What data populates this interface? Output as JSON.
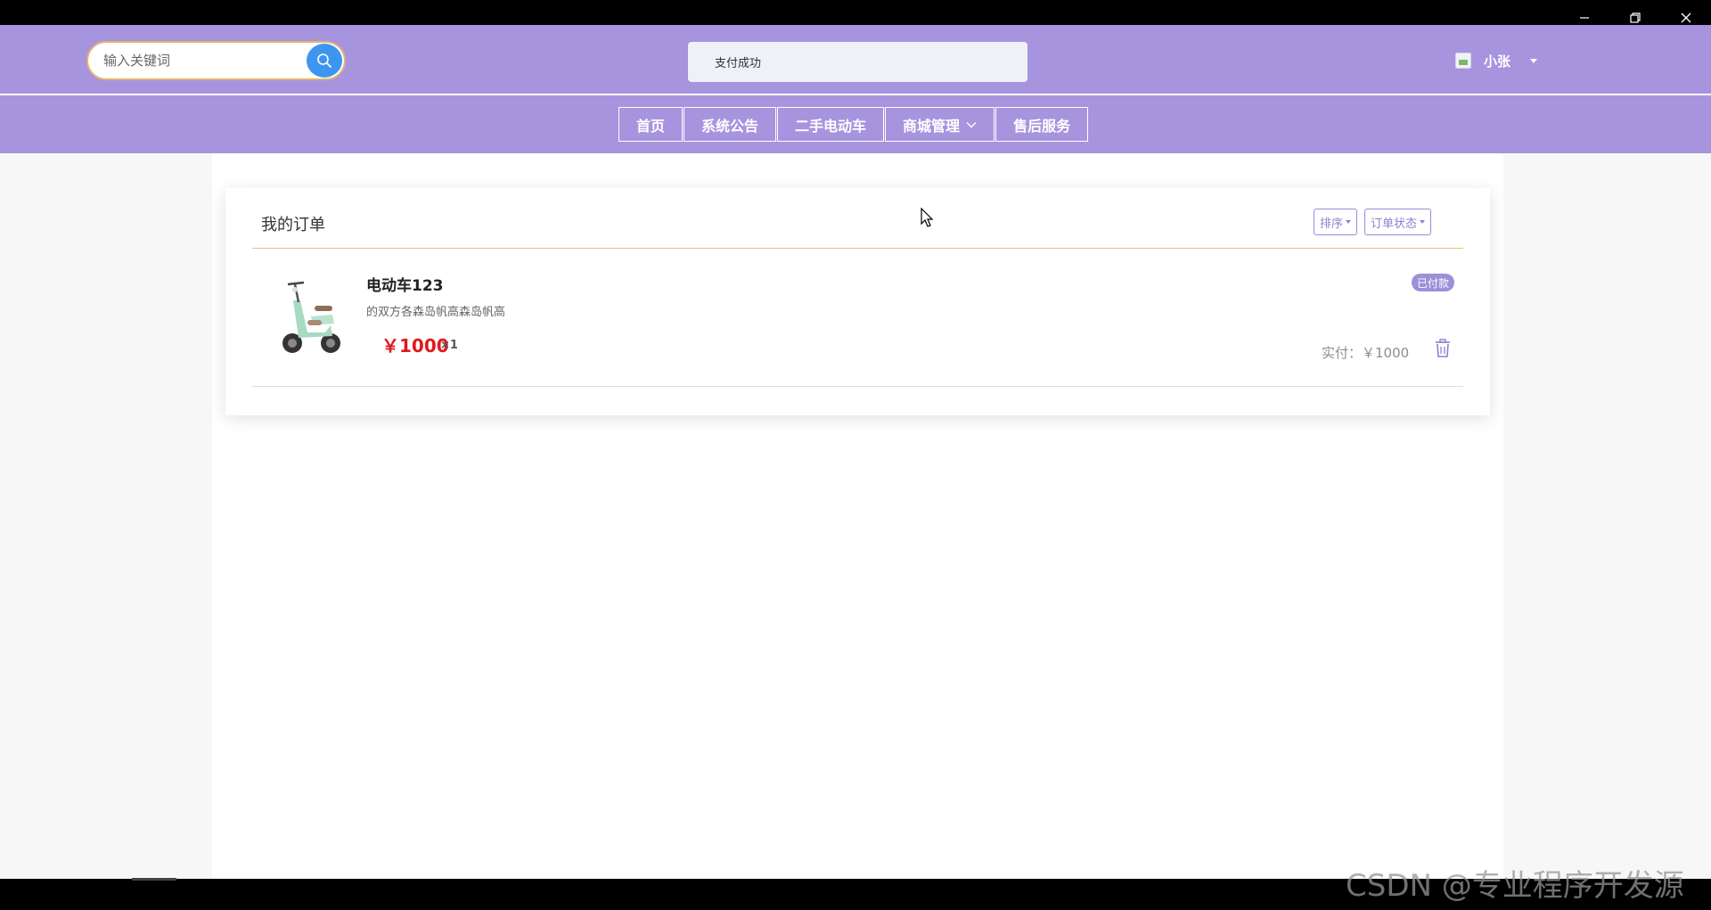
{
  "window": {
    "controls": [
      "minimize-icon",
      "restore-icon",
      "close-icon"
    ]
  },
  "header": {
    "search": {
      "placeholder": "输入关键词",
      "value": ""
    },
    "toast": "支付成功",
    "user": {
      "name": "小张"
    }
  },
  "nav": {
    "items": [
      {
        "label": "首页"
      },
      {
        "label": "系统公告"
      },
      {
        "label": "二手电动车"
      },
      {
        "label": "商城管理",
        "has_dropdown": true
      },
      {
        "label": "售后服务"
      }
    ]
  },
  "orders": {
    "title": "我的订单",
    "sort_label": "排序",
    "status_filter_label": "订单状态",
    "items": [
      {
        "name": "电动车123",
        "description": "的双方各森岛帆高森岛帆高",
        "price": "￥1000",
        "quantity": "×1",
        "status": "已付款",
        "paid_amount": "实付：￥1000"
      }
    ]
  },
  "watermark": "CSDN @专业程序开发源",
  "colors": {
    "header_bg": "#a794de",
    "search_button": "#3d95f0",
    "price": "#e0191c",
    "badge": "#9d8fd8",
    "divider_accent": "#e8c27a"
  }
}
